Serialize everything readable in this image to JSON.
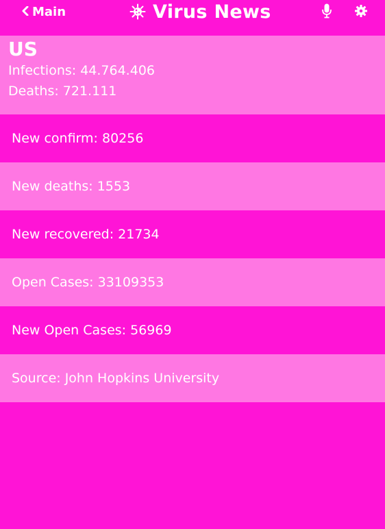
{
  "header": {
    "back_label": "Main",
    "title": "Virus News",
    "icons": [
      "chevron-left-icon",
      "virus-icon",
      "microphone-icon",
      "gear-icon"
    ]
  },
  "country": {
    "name": "US",
    "infections": "Infections: 44.764.406",
    "deaths": "Deaths: 721.111"
  },
  "rows": [
    "New confirm: 80256",
    "New deaths: 1553",
    "New recovered: 21734",
    "Open Cases: 33109353",
    "New Open Cases: 56969",
    "Source: John Hopkins University"
  ],
  "colors": {
    "background": "#ff14d6",
    "card": "#ff77e3",
    "text": "#ffffff"
  }
}
